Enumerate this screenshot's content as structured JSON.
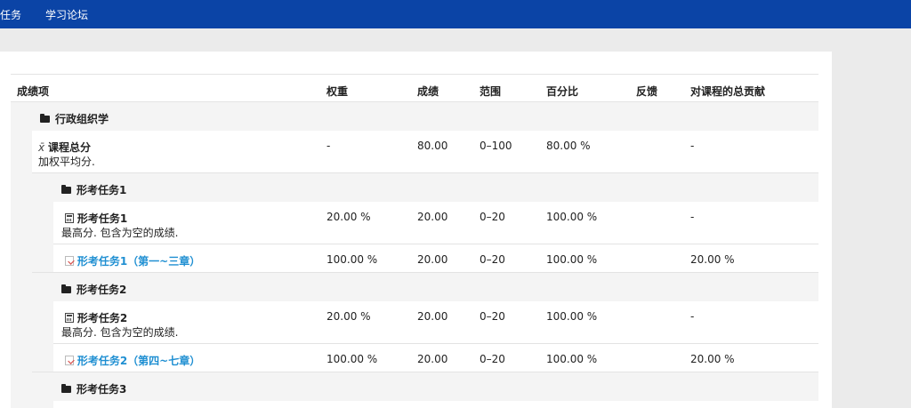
{
  "nav": {
    "item1": "任务",
    "item2": "学习论坛"
  },
  "table": {
    "headers": {
      "item": "成绩项",
      "weight": "权重",
      "grade": "成绩",
      "range": "范围",
      "percent": "百分比",
      "feedback": "反馈",
      "contribution": "对课程的总贡献"
    },
    "rows": [
      {
        "type": "category",
        "name": "行政组织学"
      },
      {
        "type": "course_total",
        "name": "课程总分",
        "desc": "加权平均分.",
        "weight": "-",
        "grade": "80.00",
        "range": "0–100",
        "percent": "80.00 %",
        "contribution": "-"
      },
      {
        "type": "category",
        "name": "形考任务1"
      },
      {
        "type": "category_total",
        "name": "形考任务1",
        "desc": "最高分. 包含为空的成绩.",
        "weight": "20.00 %",
        "grade": "20.00",
        "range": "0–20",
        "percent": "100.00 %",
        "contribution": "-"
      },
      {
        "type": "quiz",
        "name": "形考任务1（第一~三章）",
        "weight": "100.00 %",
        "grade": "20.00",
        "range": "0–20",
        "percent": "100.00 %",
        "contribution": "20.00 %"
      },
      {
        "type": "category",
        "name": "形考任务2"
      },
      {
        "type": "category_total",
        "name": "形考任务2",
        "desc": "最高分. 包含为空的成绩.",
        "weight": "20.00 %",
        "grade": "20.00",
        "range": "0–20",
        "percent": "100.00 %",
        "contribution": "-"
      },
      {
        "type": "quiz",
        "name": "形考任务2（第四~七章）",
        "weight": "100.00 %",
        "grade": "20.00",
        "range": "0–20",
        "percent": "100.00 %",
        "contribution": "20.00 %"
      },
      {
        "type": "category",
        "name": "形考任务3"
      }
    ]
  }
}
